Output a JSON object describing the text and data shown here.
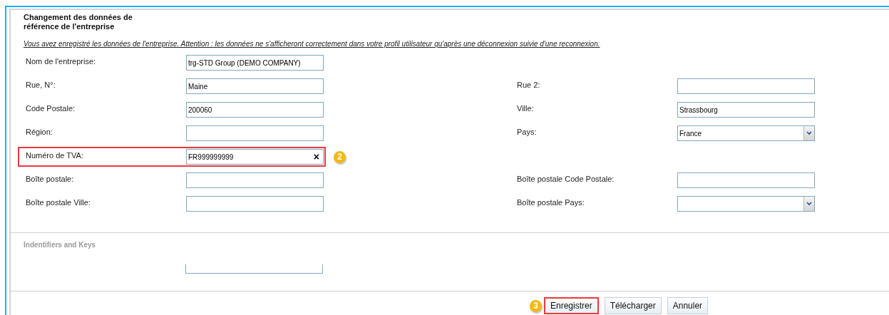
{
  "title": "Changement des données de\nréférence de l'entreprise",
  "notice": "Vous avez enregistré les données de l'entreprise. Attention : les données ne s'afficheront correctement dans votre profil utilisateur qu'après une déconnexion suivie d'une reconnexion.",
  "rows": [
    {
      "left": {
        "label": "Nom de l'entreprise:",
        "kind": "text",
        "value": "trg-STD Group (DEMO COMPANY)"
      }
    },
    {
      "left": {
        "label": "Rue, N°:",
        "kind": "text",
        "value": "Maine"
      },
      "right": {
        "label": "Rue 2:",
        "kind": "text"
      }
    },
    {
      "left": {
        "label": "Code Postale:",
        "kind": "text",
        "value": "200060"
      },
      "right": {
        "label": "Ville:",
        "kind": "text",
        "value": "Strassbourg"
      }
    },
    {
      "left": {
        "label": "Région:",
        "kind": "text"
      },
      "right": {
        "label": "Pays:",
        "kind": "select",
        "value": "France"
      }
    },
    {
      "left": {
        "label": "Numéro de TVA:",
        "kind": "text",
        "value": "FR999999999",
        "clear": "×",
        "highlighted": true,
        "badge": "2"
      }
    },
    {
      "left": {
        "label": "Boîte postale:",
        "kind": "text"
      },
      "right": {
        "label": "Boîte postale Code Postale:",
        "kind": "text"
      }
    },
    {
      "left": {
        "label": "Boîte postale Ville:",
        "kind": "text"
      },
      "right": {
        "label": "Boîte postale Pays:",
        "kind": "select"
      }
    }
  ],
  "section": {
    "heading": "Indentifiers and Keys"
  },
  "buttons": [
    {
      "label": "Enregistrer",
      "highlighted": true,
      "badge": "3"
    },
    {
      "label": "Télécharger",
      "highlighted": false
    },
    {
      "label": "Annuler",
      "highlighted": false
    }
  ]
}
